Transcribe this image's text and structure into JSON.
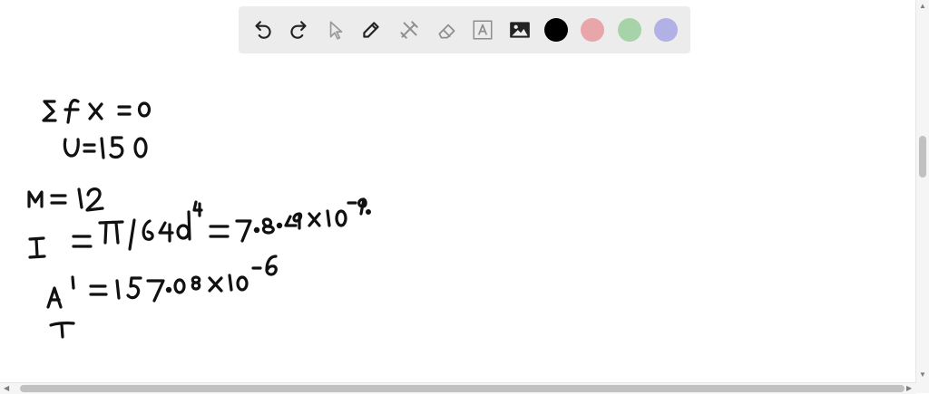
{
  "toolbar": {
    "tools": [
      {
        "icon": "undo-icon"
      },
      {
        "icon": "redo-icon"
      },
      {
        "icon": "pointer-icon"
      },
      {
        "icon": "pen-icon"
      },
      {
        "icon": "tools-icon"
      },
      {
        "icon": "eraser-icon"
      },
      {
        "icon": "text-icon"
      },
      {
        "icon": "image-icon"
      }
    ],
    "colors": [
      "#000000",
      "#e8a6ab",
      "#a6d4a8",
      "#b2b1e6"
    ]
  }
}
